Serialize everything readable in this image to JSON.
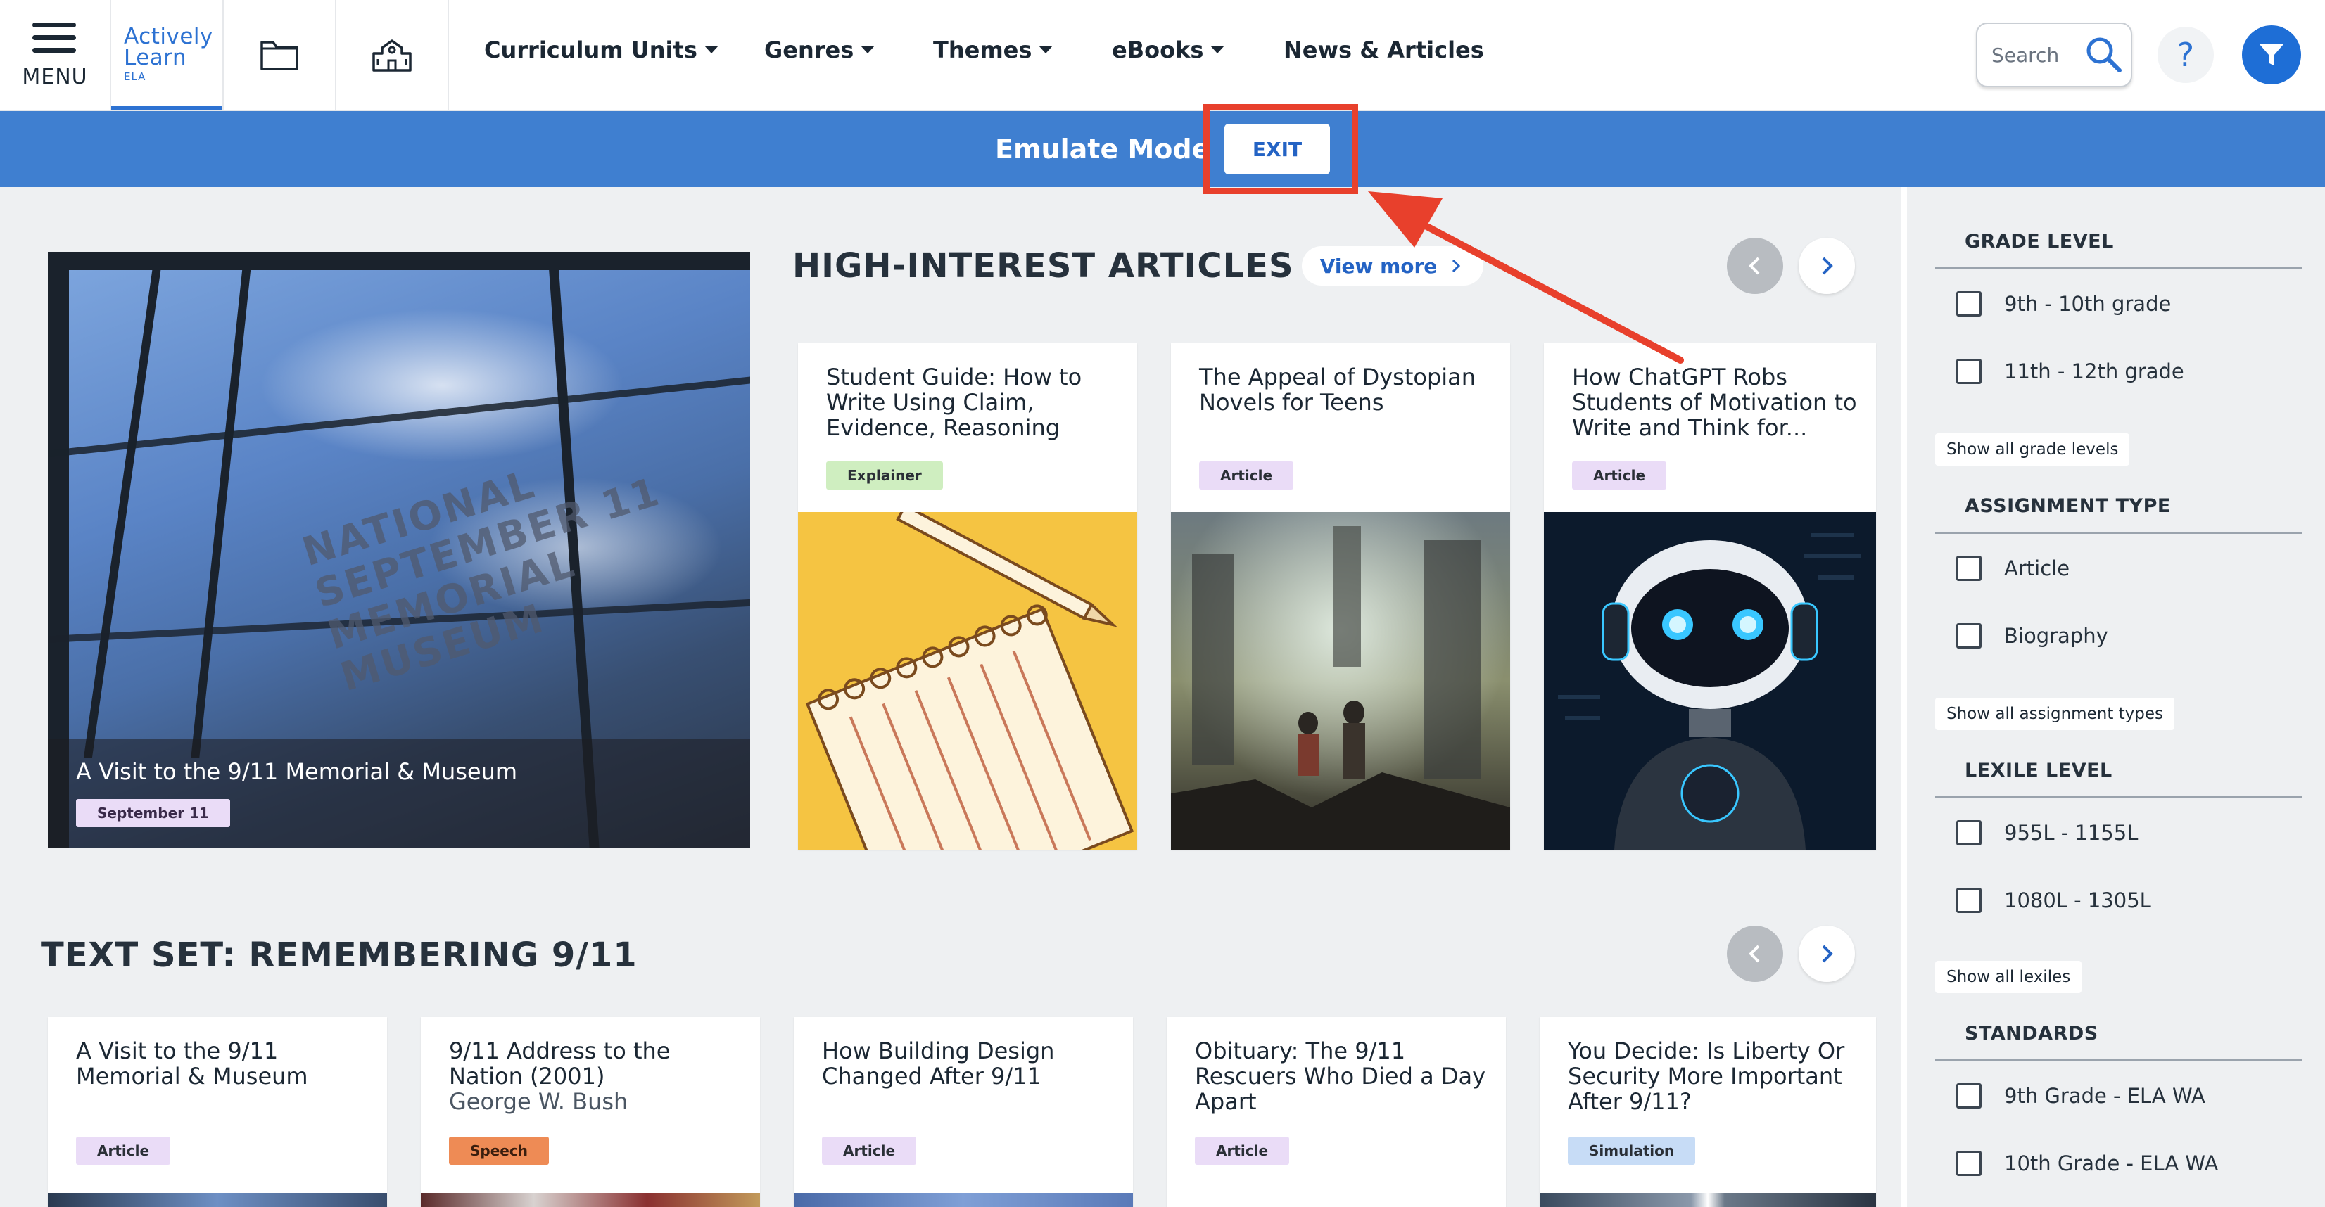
{
  "nav": {
    "menu_label": "MENU",
    "logo_line1": "Actively",
    "logo_line2": "Learn",
    "logo_line3": "ELA",
    "items": [
      "Curriculum Units",
      "Genres",
      "Themes",
      "eBooks",
      "News & Articles"
    ],
    "search_placeholder": "Search",
    "help_label": "?"
  },
  "emulate": {
    "label": "Emulate Mode",
    "exit_label": "EXIT"
  },
  "hero": {
    "title": "A Visit to the 9/11 Memorial & Museum",
    "tag": "September 11",
    "sign_text": [
      "NATIONAL",
      "SEPTEMBER 11",
      "MEMORIAL",
      "MUSEUM"
    ]
  },
  "high_interest": {
    "title": "HIGH-INTEREST ARTICLES",
    "view_more": "View more",
    "cards": [
      {
        "title": "Student Guide: How to Write Using Claim, Evidence, Reasoning",
        "tag": "Explainer"
      },
      {
        "title": "The Appeal of Dystopian Novels for Teens",
        "tag": "Article"
      },
      {
        "title": "How ChatGPT Robs Students of Motivation to Write and Think for...",
        "tag": "Article"
      }
    ]
  },
  "text_set": {
    "title": "TEXT SET: REMEMBERING 9/11",
    "cards": [
      {
        "title": "A Visit to the 9/11 Memorial & Museum",
        "author": "",
        "tag": "Article"
      },
      {
        "title": "9/11 Address to the Nation (2001)",
        "author": "George W. Bush",
        "tag": "Speech"
      },
      {
        "title": "How Building Design Changed After 9/11",
        "author": "",
        "tag": "Article"
      },
      {
        "title": "Obituary: The 9/11 Rescuers Who Died a Day Apart",
        "author": "",
        "tag": "Article"
      },
      {
        "title": "You Decide: Is Liberty Or Security More Important After 9/11?",
        "author": "",
        "tag": "Simulation"
      }
    ]
  },
  "sidebar": {
    "grade_level": {
      "heading": "GRADE LEVEL",
      "options": [
        "9th - 10th grade",
        "11th - 12th grade"
      ],
      "show_all": "Show all grade levels"
    },
    "assignment_type": {
      "heading": "ASSIGNMENT TYPE",
      "options": [
        "Article",
        "Biography"
      ],
      "show_all": "Show all assignment types"
    },
    "lexile_level": {
      "heading": "LEXILE LEVEL",
      "options": [
        "955L - 1155L",
        "1080L - 1305L"
      ],
      "show_all": "Show all lexiles"
    },
    "standards": {
      "heading": "STANDARDS",
      "options": [
        "9th Grade - ELA WA",
        "10th Grade - ELA WA"
      ]
    }
  },
  "colors": {
    "brand_blue": "#2d72d2",
    "emulate_bar": "#3f7fd0",
    "highlight_red": "#e8402c"
  },
  "icons": [
    "hamburger-icon",
    "folder-icon",
    "school-icon",
    "caret-down-icon",
    "search-icon",
    "help-icon",
    "filter-icon",
    "chevron-left-icon",
    "chevron-right-icon"
  ]
}
